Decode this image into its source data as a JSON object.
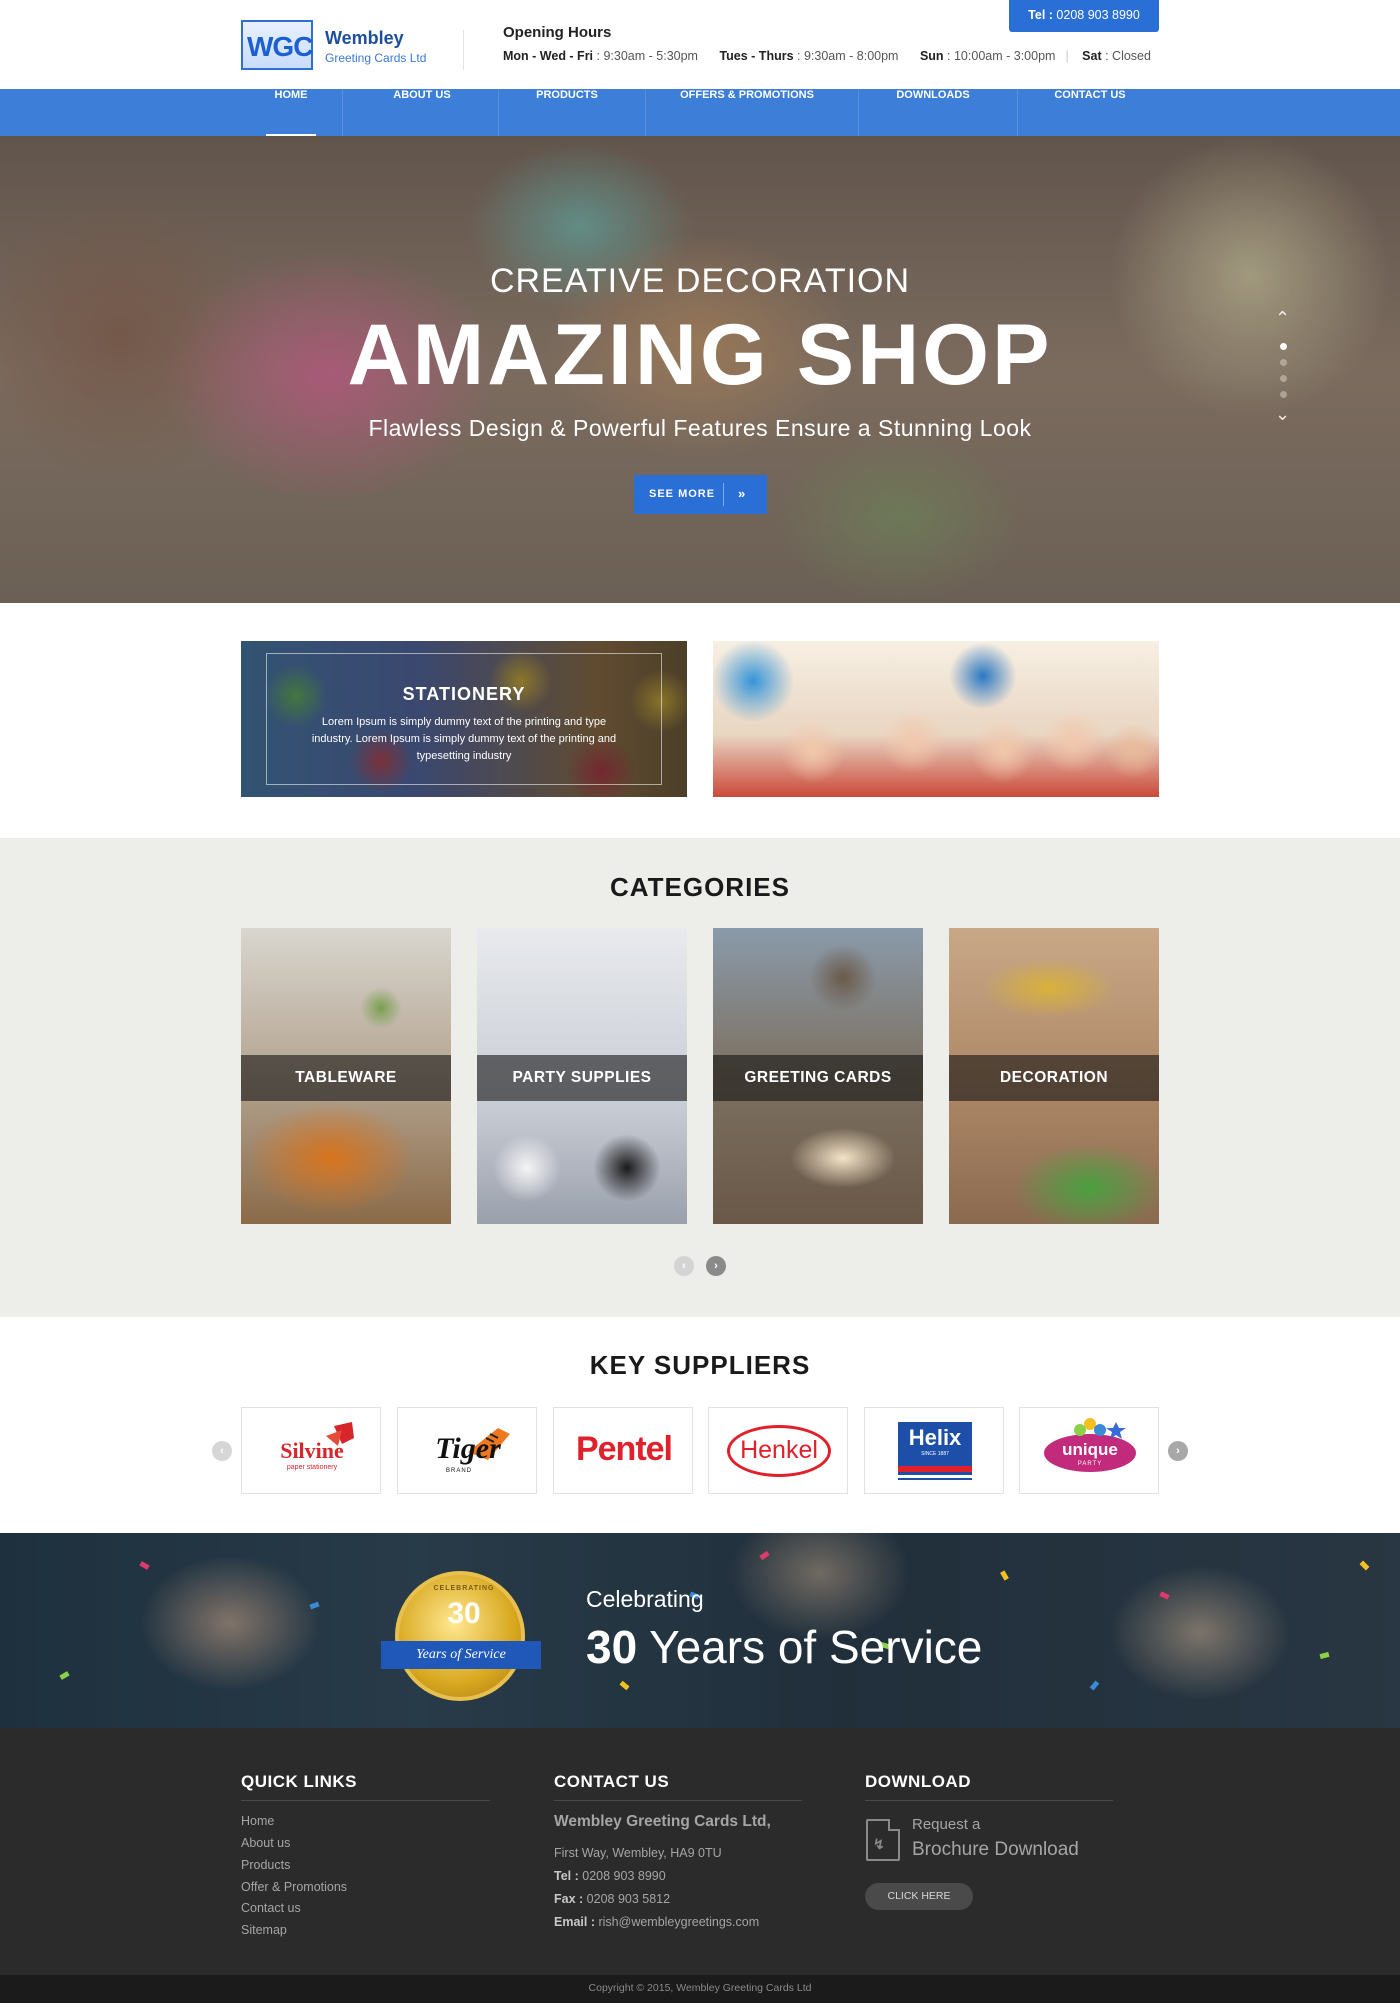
{
  "header": {
    "logo_mark": "WGC",
    "logo_name": "Wembley",
    "logo_sub": "Greeting Cards Ltd",
    "hours_title": "Opening Hours",
    "hours": [
      {
        "days": "Mon - Wed - Fri",
        "time": "9:30am - 5:30pm"
      },
      {
        "days": "Tues - Thurs",
        "time": "9:30am - 8:00pm"
      },
      {
        "days": "Sun",
        "time": "10:00am - 3:00pm"
      },
      {
        "days": "Sat",
        "time": "Closed"
      }
    ],
    "tel_label": "Tel :",
    "tel_number": "0208 903 8990"
  },
  "nav": {
    "items": [
      "HOME",
      "ABOUT US",
      "PRODUCTS",
      "OFFERS & PROMOTIONS",
      "DOWNLOADS",
      "CONTACT US"
    ],
    "active": "HOME"
  },
  "hero": {
    "kicker": "CREATIVE DECORATION",
    "title": "AMAZING SHOP",
    "subtitle": "Flawless Design & Powerful Features Ensure a Stunning Look",
    "button": "SEE MORE",
    "button_icon": "»",
    "slides": 4,
    "active_slide": 1
  },
  "promo": {
    "title": "STATIONERY",
    "text": "Lorem Ipsum is simply dummy text of the printing and type industry. Lorem Ipsum is simply dummy text of the printing and typesetting industry"
  },
  "categories": {
    "title": "CATEGORIES",
    "items": [
      "TABLEWARE",
      "PARTY SUPPLIES",
      "GREETING CARDS",
      "DECORATION"
    ]
  },
  "suppliers": {
    "title": "KEY SUPPLIERS",
    "items": [
      {
        "name": "Silvine",
        "tag": "paper stationery"
      },
      {
        "name": "Tiger",
        "tag": "BRAND"
      },
      {
        "name": "Pentel",
        "tag": ""
      },
      {
        "name": "Henkel",
        "tag": ""
      },
      {
        "name": "Helix",
        "tag": "SINCE 1887"
      },
      {
        "name": "unique",
        "tag": "PARTY"
      }
    ]
  },
  "celebrate": {
    "badge_top": "CELEBRATING",
    "badge_number": "30",
    "badge_ribbon": "Years of Service",
    "small": "Celebrating",
    "big_number": "30",
    "big_text": " Years of Service"
  },
  "footer": {
    "quick_links_title": "QUICK LINKS",
    "links": [
      "Home",
      "About us",
      "Products",
      "Offer & Promotions",
      "Contact us",
      "Sitemap"
    ],
    "contact_title": "CONTACT US",
    "company": "Wembley Greeting Cards Ltd,",
    "address": "First Way, Wembley, HA9 0TU",
    "tel_label": "Tel :",
    "tel": "0208 903 8990",
    "fax_label": "Fax :",
    "fax": "0208 903 5812",
    "email_label": "Email :",
    "email": "rish@wembleygreetings.com",
    "download_title": "DOWNLOAD",
    "request_small": "Request a",
    "request_big": "Brochure Download",
    "click_here": "CLICK HERE",
    "copyright": "Copyright © 2015, Wembley Greeting Cards Ltd"
  },
  "colors": {
    "brand_blue": "#2a6fd6",
    "nav_blue": "#3d7ed8",
    "footer_bg": "#2b2b2b"
  }
}
